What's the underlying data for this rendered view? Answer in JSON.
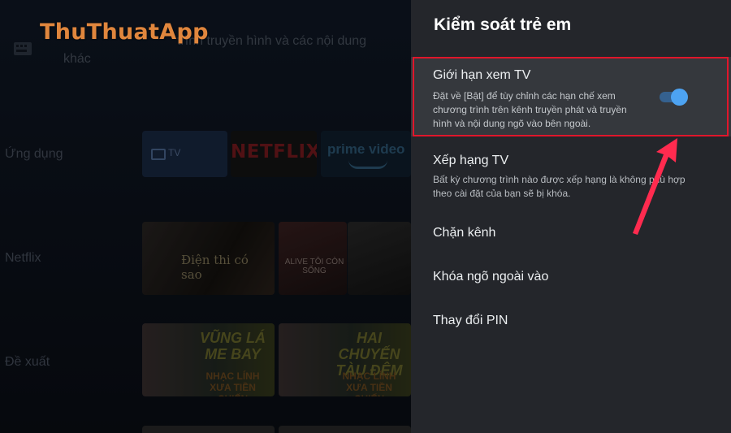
{
  "watermark": "ThuThuatApp",
  "background": {
    "notice": {
      "line1": "trình truyền hình và các nội dung",
      "line2": "khác"
    },
    "rows": {
      "apps": "Ứng dụng",
      "netflix": "Netflix",
      "suggested": "Đề xuất"
    },
    "tiles": {
      "tv": "TV",
      "netflix": "NETFLIX",
      "prime": "prime video"
    },
    "posters": {
      "p1_title": "Điện thi có sao",
      "p2_title": "ALIVE TÔI CÒN SỐNG",
      "p4_title": "VŨNG LÁ ME BAY",
      "p4_sub": "NHẠC LÍNH XƯA TIỀN CHIẾN",
      "p5_title": "HAI CHUYẾN TÀU ĐÊM",
      "p5_sub": "NHẠC LÍNH XƯA TIỀN CHIẾN"
    }
  },
  "panel": {
    "title": "Kiểm soát trẻ em",
    "items": [
      {
        "label": "Giới hạn xem TV",
        "description": "Đặt về [Bật] để tùy chỉnh các hạn chế xem chương trình trên kênh truyền phát và truyền hình và nội dung ngõ vào bên ngoài.",
        "toggle": "on"
      },
      {
        "label": "Xếp hạng TV",
        "description": "Bất kỳ chương trình nào được xếp hạng là không phù hợp theo cài đặt của bạn sẽ bị khóa."
      },
      {
        "label": "Chặn kênh"
      },
      {
        "label": "Khóa ngõ ngoài vào"
      },
      {
        "label": "Thay đổi PIN"
      }
    ]
  },
  "colors": {
    "panel_bg": "#24262b",
    "selected_bg": "#35383d",
    "accent_blue": "#4da3f2",
    "annotation_red": "#e0162b",
    "watermark": "#e0863d"
  }
}
